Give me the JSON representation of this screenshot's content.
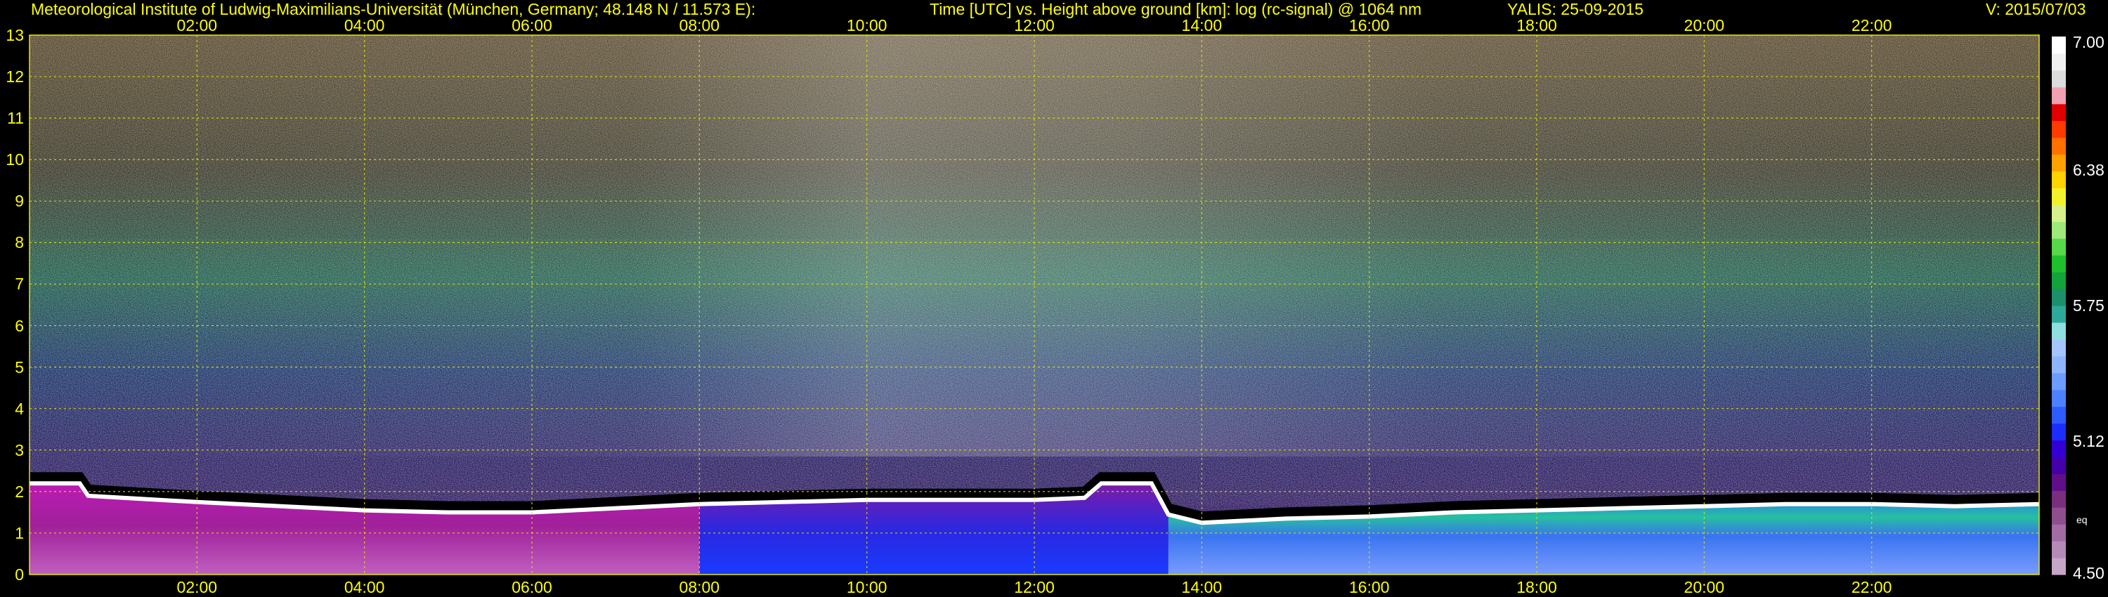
{
  "header": {
    "institute": "Meteorological Institute of Ludwig-Maximilians-Universität (München, Germany; 48.148 N / 11.573 E):",
    "title": "Time [UTC] vs. Height above ground [km]: log (rc-signal) @ 1064 nm",
    "station": "YALIS: 25-09-2015",
    "version": "V: 2015/07/03"
  },
  "chart_data": {
    "type": "heatmap",
    "title": "Time [UTC] vs. Height above ground [km]: log (rc-signal) @ 1064 nm",
    "x_ticks": [
      "02:00",
      "04:00",
      "06:00",
      "08:00",
      "10:00",
      "12:00",
      "14:00",
      "16:00",
      "18:00",
      "20:00",
      "22:00"
    ],
    "x_range_hours": [
      0,
      24
    ],
    "y_ticks": [
      "0",
      "1",
      "2",
      "3",
      "4",
      "5",
      "6",
      "7",
      "8",
      "9",
      "10",
      "11",
      "12",
      "13"
    ],
    "y_range_km": [
      0,
      13
    ],
    "grid": true,
    "colorbar": {
      "ticks": [
        "7.00",
        "6.38",
        "5.75",
        "5.12",
        "4.50"
      ],
      "range": [
        4.5,
        7.0
      ],
      "label": "eq",
      "colors": [
        "#c7a5c7",
        "#b58ab8",
        "#a36ca5",
        "#8e4e90",
        "#7a2f7e",
        "#5f0f88",
        "#4400aa",
        "#3300d4",
        "#1c2eff",
        "#2e5cff",
        "#4c82ff",
        "#6c9cff",
        "#8fb4ff",
        "#a5c5ff",
        "#8fdfe0",
        "#2ea89a",
        "#1d8f6a",
        "#14a23a",
        "#1fc02e",
        "#56d84a",
        "#9fe87c",
        "#d6f08c",
        "#f2f22a",
        "#ffd200",
        "#ffa100",
        "#ff7000",
        "#ff3a00",
        "#e00000",
        "#f0a0b0",
        "#dcdcdc",
        "#f0f0f0",
        "#ffffff"
      ]
    },
    "boundary_layer_top_km": [
      [
        0.0,
        2.35
      ],
      [
        0.6,
        2.35
      ],
      [
        0.7,
        2.05
      ],
      [
        2.0,
        1.9
      ],
      [
        3.0,
        1.8
      ],
      [
        4.0,
        1.7
      ],
      [
        5.0,
        1.65
      ],
      [
        6.0,
        1.65
      ],
      [
        7.0,
        1.75
      ],
      [
        8.0,
        1.85
      ],
      [
        9.0,
        1.9
      ],
      [
        10.0,
        1.95
      ],
      [
        11.0,
        1.95
      ],
      [
        12.0,
        1.95
      ],
      [
        12.6,
        2.0
      ],
      [
        12.8,
        2.35
      ],
      [
        13.4,
        2.35
      ],
      [
        13.6,
        1.6
      ],
      [
        14.0,
        1.4
      ],
      [
        15.0,
        1.5
      ],
      [
        16.0,
        1.55
      ],
      [
        17.0,
        1.65
      ],
      [
        18.0,
        1.7
      ],
      [
        19.0,
        1.75
      ],
      [
        20.0,
        1.8
      ],
      [
        21.0,
        1.85
      ],
      [
        22.0,
        1.85
      ],
      [
        23.0,
        1.8
      ],
      [
        24.0,
        1.85
      ]
    ]
  }
}
